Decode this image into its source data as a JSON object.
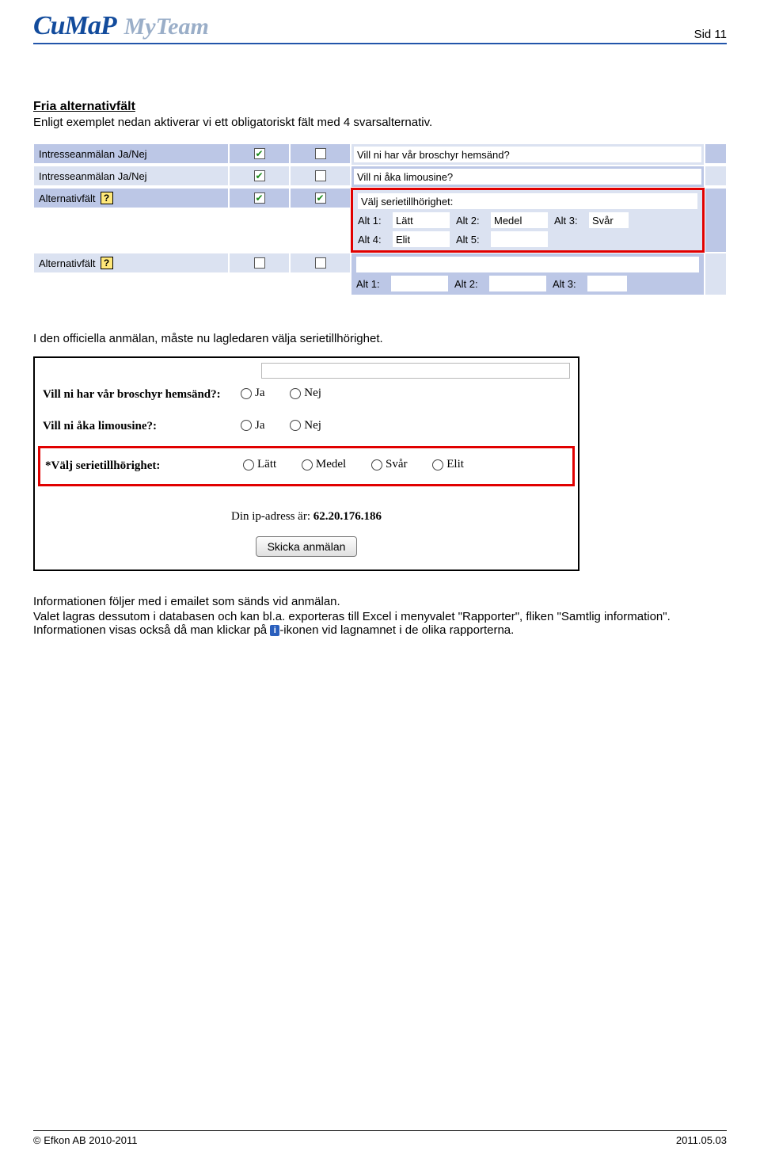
{
  "header": {
    "brand_left": "CuMaP",
    "brand_right": "MyTeam",
    "page_label": "Sid 11"
  },
  "section1": {
    "heading": "Fria alternativfält",
    "intro": "Enligt exemplet nedan aktiverar vi ett obligatoriskt fält med 4 svarsalternativ."
  },
  "admin": {
    "rows": [
      {
        "label": "Intresseanmälan Ja/Nej",
        "chk1": true,
        "chk2": false,
        "question": "Vill ni har vår broschyr hemsänd?"
      },
      {
        "label": "Intresseanmälan Ja/Nej",
        "chk1": true,
        "chk2": false,
        "question": "Vill ni åka limousine?"
      }
    ],
    "alt_row": {
      "label": "Alternativfält",
      "chk1": true,
      "chk2": true,
      "question": "Välj serietillhörighet:",
      "alts": {
        "a1l": "Alt 1:",
        "a1v": "Lätt",
        "a2l": "Alt 2:",
        "a2v": "Medel",
        "a3l": "Alt 3:",
        "a3v": "Svår",
        "a4l": "Alt 4:",
        "a4v": "Elit",
        "a5l": "Alt 5:",
        "a5v": ""
      }
    },
    "alt_row2": {
      "label": "Alternativfält",
      "chk1": false,
      "chk2": false,
      "question": "",
      "alts": {
        "a1l": "Alt 1:",
        "a2l": "Alt 2:",
        "a3l": "Alt 3:"
      }
    }
  },
  "section2": {
    "intro": "I den officiella anmälan, måste nu lagledaren välja serietillhörighet."
  },
  "form": {
    "rows": [
      {
        "label": "Vill ni har vår broschyr hemsänd?:",
        "opts": [
          "Ja",
          "Nej"
        ]
      },
      {
        "label": "Vill ni åka limousine?:",
        "opts": [
          "Ja",
          "Nej"
        ]
      }
    ],
    "req_row": {
      "label": "*Välj serietillhörighet:",
      "opts": [
        "Lätt",
        "Medel",
        "Svår",
        "Elit"
      ]
    },
    "ip_label": "Din ip-adress är: ",
    "ip_value": "62.20.176.186",
    "submit": "Skicka anmälan"
  },
  "section3": {
    "p1a": "Informationen följer med i emailet som sänds vid anmälan.",
    "p1b": "Valet lagras dessutom i databasen och kan bl.a. exporteras till Excel i menyvalet \"Rapporter\", fliken \"Samtlig information\". Informationen visas också då man klickar på ",
    "p1c": "-ikonen vid lagnamnet i de olika rapporterna.",
    "info_glyph": "i"
  },
  "footer": {
    "left": "© Efkon AB 2010-2011",
    "right": "2011.05.03"
  }
}
